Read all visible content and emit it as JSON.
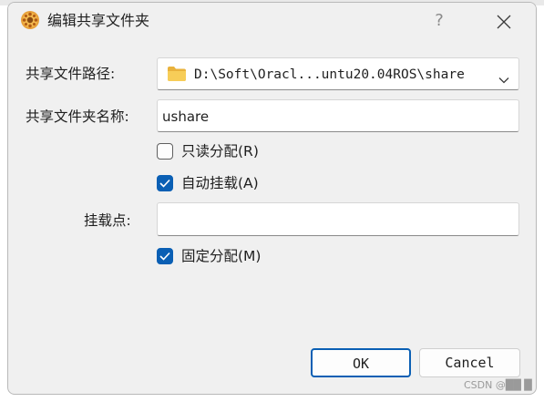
{
  "window": {
    "title": "编辑共享文件夹",
    "help_label": "?",
    "icon": "virtualbox-app-icon",
    "close_icon": "close-icon"
  },
  "form": {
    "path_label": "共享文件路径:",
    "path_value": "D:\\Soft\\Oracl...untu20.04ROS\\share",
    "path_icon": "folder-icon",
    "name_label": "共享文件夹名称:",
    "name_value": "ushare",
    "mount_label": "挂载点:",
    "mount_value": ""
  },
  "options": {
    "readonly": {
      "label": "只读分配(R)",
      "checked": false
    },
    "automount": {
      "label": "自动挂载(A)",
      "checked": true
    },
    "permanent": {
      "label": "固定分配(M)",
      "checked": true
    }
  },
  "buttons": {
    "ok": "OK",
    "cancel": "Cancel"
  },
  "watermark": "CSDN @██ █",
  "colors": {
    "accent": "#0a5fb4",
    "dialog_bg": "#f0f0f0",
    "folder": "#f2c34b"
  }
}
